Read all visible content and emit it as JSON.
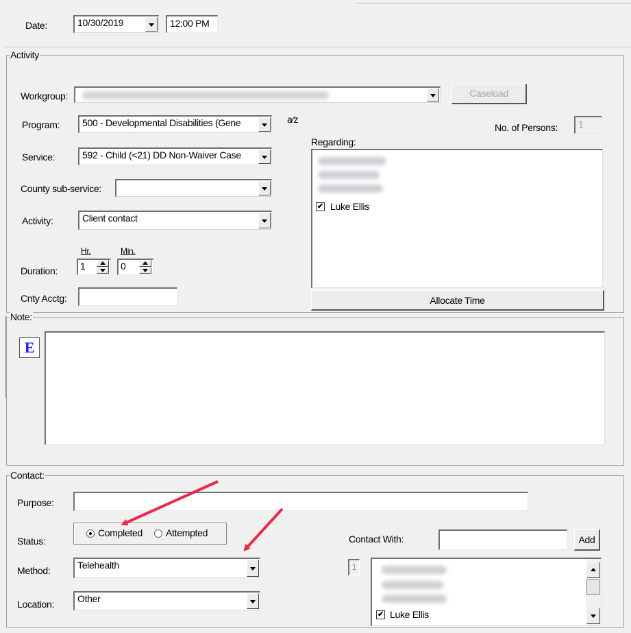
{
  "header": {
    "date_label": "Date:",
    "date_value": "10/30/2019",
    "time_value": "12:00 PM"
  },
  "activity": {
    "title": "Activity",
    "workgroup_label": "Workgroup:",
    "caseload_button": "Caseload",
    "program_label": "Program:",
    "program_value": "500 - Developmental Disabilities (Gene",
    "service_label": "Service:",
    "service_value": "592 - Child (<21) DD Non-Waiver Case",
    "county_sub_service_label": "County sub-service:",
    "county_sub_service_value": "",
    "activity_label": "Activity:",
    "activity_value": "Client contact",
    "duration_label": "Duration:",
    "hr_label": "Hr.",
    "hr_value": "1",
    "min_label": "Min.",
    "min_value": "0",
    "cnty_acctg_label": "Cnty Acctg:",
    "cnty_acctg_value": "",
    "spell_icon_text": "a⁄z",
    "persons_label": "No. of Persons:",
    "persons_value": "1",
    "regarding_label": "Regarding:",
    "regarding_item": "Luke  Ellis",
    "allocate_button": "Allocate Time"
  },
  "note": {
    "title": "Note:",
    "editor_icon": "E",
    "text": ""
  },
  "contact": {
    "title": "Contact:",
    "purpose_label": "Purpose:",
    "purpose_value": "",
    "status_label": "Status:",
    "completed_label": "Completed",
    "attempted_label": "Attempted",
    "method_label": "Method:",
    "method_value": "Telehealth",
    "location_label": "Location:",
    "location_value": "Other",
    "contact_with_label": "Contact With:",
    "contact_with_value": "",
    "add_button": "Add",
    "count_value": "1",
    "contact_item": "Luke  Ellis"
  },
  "colors": {
    "arrow": "#e8294c",
    "editor_icon": "#1a1aff"
  }
}
